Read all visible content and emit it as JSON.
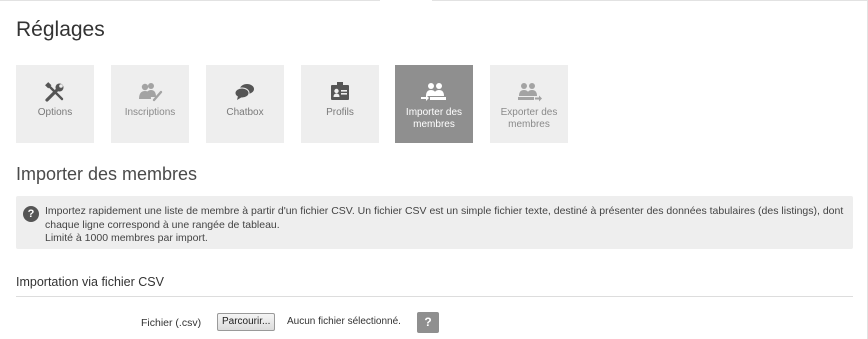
{
  "page": {
    "title": "Réglages"
  },
  "tiles": [
    {
      "label": "Options",
      "icon": "tools-icon",
      "active": false
    },
    {
      "label": "Inscriptions",
      "icon": "users-pen-icon",
      "active": false
    },
    {
      "label": "Chatbox",
      "icon": "speech-bubbles-icon",
      "active": false
    },
    {
      "label": "Profils",
      "icon": "id-card-icon",
      "active": false
    },
    {
      "label": "Importer des membres",
      "icon": "import-users-icon",
      "active": true
    },
    {
      "label": "Exporter des membres",
      "icon": "export-users-icon",
      "active": false
    }
  ],
  "section": {
    "title": "Importer des membres"
  },
  "info": {
    "icon": "question-icon",
    "icon_text": "?",
    "line1": "Importez rapidement une liste de membre à partir d'un fichier CSV. Un fichier CSV est un simple fichier texte, destiné à présenter des données tabulaires (des listings), dont chaque ligne correspond à une rangée de tableau.",
    "line2": "Limité à 1000 membres par import."
  },
  "import_form": {
    "title": "Importation via fichier CSV",
    "file_label": "Fichier (.csv)",
    "browse_label": "Parcourir...",
    "file_status": "Aucun fichier sélectionné.",
    "help_label": "?"
  },
  "colors": {
    "tile_bg": "#eeeeee",
    "tile_active_bg": "#8f8f8f",
    "icon_gray": "#555555"
  }
}
